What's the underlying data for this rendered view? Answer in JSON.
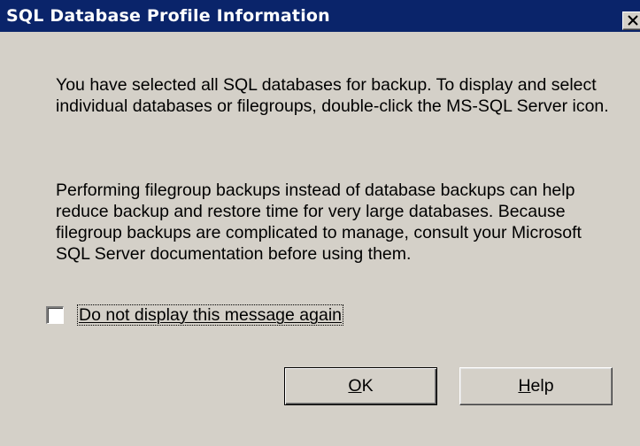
{
  "window": {
    "title": "SQL Database Profile Information",
    "close_symbol": "×"
  },
  "message": {
    "paragraph1": "You have selected all SQL databases for backup. To display and select individual databases or filegroups, double-click the MS-SQL Server icon.",
    "paragraph2": "Performing filegroup backups instead of database backups can help reduce backup and restore time for very large databases. Because filegroup backups are complicated to manage, consult your Microsoft SQL Server documentation before using them."
  },
  "checkbox": {
    "label": "Do not display this message again",
    "checked": false
  },
  "buttons": {
    "ok_label": "OK",
    "help_label": "Help"
  },
  "colors": {
    "titlebar": "#0a246a",
    "dialog_face": "#d4d0c8"
  }
}
